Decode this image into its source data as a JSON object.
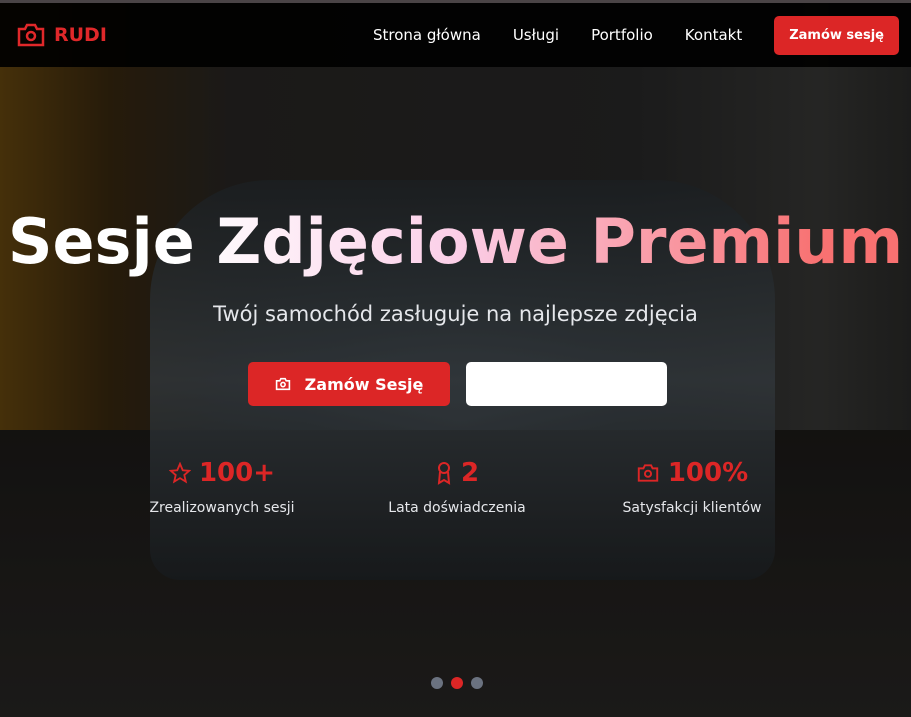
{
  "nav": {
    "brand": "RUDI",
    "links": [
      "Strona główna",
      "Usługi",
      "Portfolio",
      "Kontakt"
    ],
    "cta": "Zamów sesję"
  },
  "hero": {
    "title": "Sesje Zdjęciowe Premium",
    "subtitle": "Twój samochód zasługuje na najlepsze zdjęcia",
    "primary_button": "Zamów Sesję",
    "secondary_button": "",
    "stats": [
      {
        "icon": "star-icon",
        "value": "100+",
        "label": "Zrealizowanych sesji"
      },
      {
        "icon": "award-icon",
        "value": "2",
        "label": "Lata doświadczenia"
      },
      {
        "icon": "camera-icon",
        "value": "100%",
        "label": "Satysfakcji klientów"
      }
    ],
    "carousel": {
      "slides": 3,
      "active": 2
    }
  },
  "colors": {
    "accent": "#dc2626"
  }
}
